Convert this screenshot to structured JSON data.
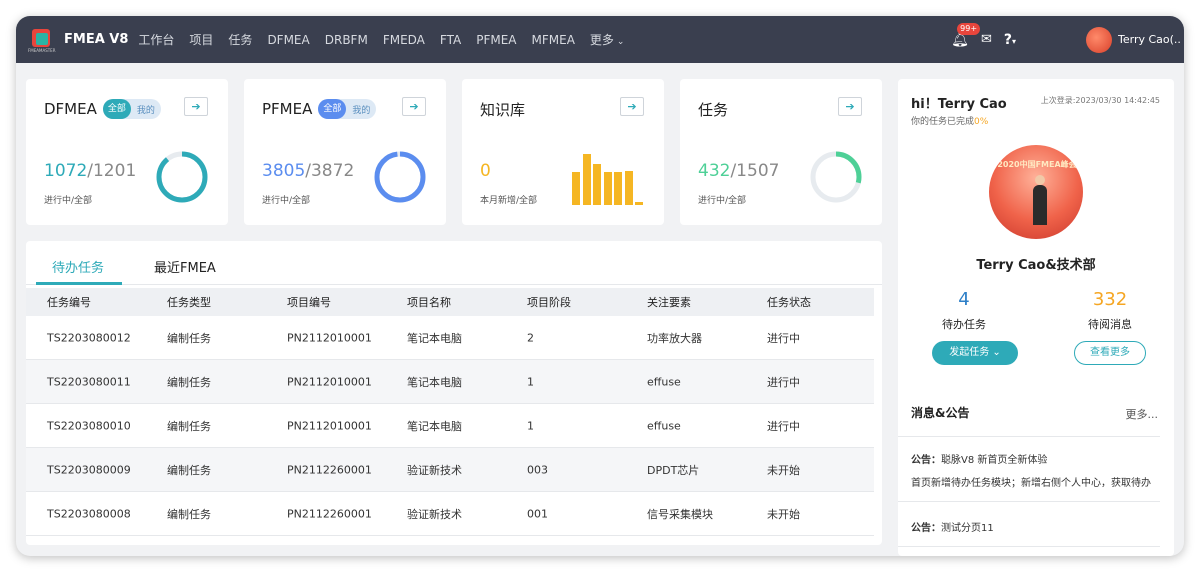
{
  "app": {
    "brand": "FMEA V8",
    "logo_caption": "FMEAMASTER"
  },
  "nav": [
    "工作台",
    "项目",
    "任务",
    "DFMEA",
    "DRBFM",
    "FMEDA",
    "FTA",
    "PFMEA",
    "MFMEA",
    "更多"
  ],
  "topbar": {
    "notification_badge": "99+",
    "user_name": "Terry Cao(..."
  },
  "cards": [
    {
      "title": "DFMEA",
      "seg_on": "全部",
      "seg_off": "我的",
      "num_a": "1072",
      "num_b": "/1201",
      "sub": "进行中/全部",
      "accent": "#2eaab8",
      "progress": 0.89
    },
    {
      "title": "PFMEA",
      "seg_on": "全部",
      "seg_off": "我的",
      "num_a": "3805",
      "num_b": "/3872",
      "sub": "进行中/全部",
      "accent": "#5b8def",
      "progress": 0.98
    },
    {
      "title": "知识库",
      "num_a": "0",
      "num_b": "",
      "sub": "本月新增/全部",
      "accent": "#f5b623",
      "bars": [
        0.5,
        0.78,
        0.62,
        0.5,
        0.5,
        0.52,
        0.05
      ]
    },
    {
      "title": "任务",
      "num_a": "432",
      "num_b": "/1507",
      "sub": "进行中/全部",
      "accent": "#4ed097",
      "progress": 0.29
    }
  ],
  "tabs": [
    "待办任务",
    "最近FMEA"
  ],
  "table": {
    "headers": [
      "任务编号",
      "任务类型",
      "项目编号",
      "项目名称",
      "项目阶段",
      "关注要素",
      "任务状态"
    ],
    "rows": [
      [
        "TS2203080012",
        "编制任务",
        "PN2112010001",
        "笔记本电脑",
        "2",
        "功率放大器",
        "进行中"
      ],
      [
        "TS2203080011",
        "编制任务",
        "PN2112010001",
        "笔记本电脑",
        "1",
        "effuse",
        "进行中"
      ],
      [
        "TS2203080010",
        "编制任务",
        "PN2112010001",
        "笔记本电脑",
        "1",
        "effuse",
        "进行中"
      ],
      [
        "TS2203080009",
        "编制任务",
        "PN2112260001",
        "验证新技术",
        "003",
        "DPDT芯片",
        "未开始"
      ],
      [
        "TS2203080008",
        "编制任务",
        "PN2112260001",
        "验证新技术",
        "001",
        "信号采集模块",
        "未开始"
      ]
    ]
  },
  "profile": {
    "greeting": "hi！Terry Cao",
    "last_login": "上次登录:2023/03/30 14:42:45",
    "done_prefix": "你的任务已完成",
    "done_value": "0%",
    "banner_text": "2020中国FMEA峰会",
    "name_dept": "Terry Cao&技术部",
    "todo_count": "4",
    "todo_label": "待办任务",
    "unread_count": "332",
    "unread_label": "待阅消息",
    "start_task": "发起任务",
    "view_more": "查看更多"
  },
  "messages": {
    "title": "消息&公告",
    "more": "更多...",
    "items": [
      {
        "tag": "公告：",
        "text": "聪脉V8 新首页全新体验",
        "detail": "首页新增待办任务模块；新增右侧个人中心，获取待办"
      },
      {
        "tag": "公告：",
        "text": "测试分页11"
      }
    ]
  }
}
